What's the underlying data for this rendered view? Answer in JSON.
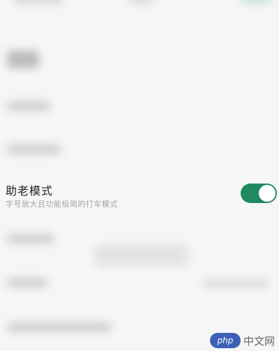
{
  "setting": {
    "title": "助老模式",
    "description": "字号放大且功能极简的打车模式",
    "toggle_on": true
  },
  "watermark": {
    "logo_text": "php",
    "site_text": "中文网"
  },
  "colors": {
    "accent": "#1f8a60",
    "background": "#f6f6f6",
    "title_text": "#222222",
    "desc_text": "#a5a5a5"
  }
}
